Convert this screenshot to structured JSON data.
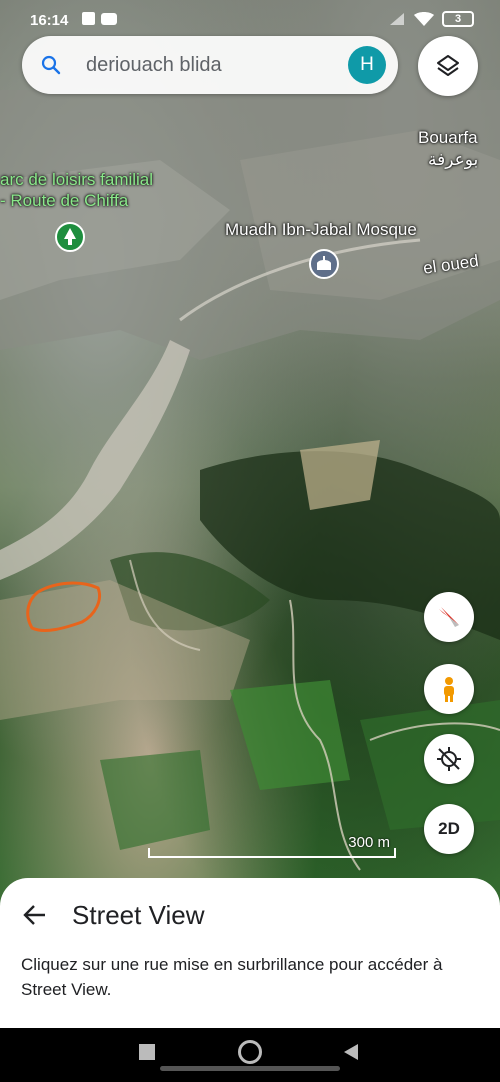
{
  "status_bar": {
    "time": "16:14",
    "battery": "3"
  },
  "search": {
    "query": "deriouach blida",
    "avatar_initial": "H"
  },
  "map_labels": {
    "bouarfa_latin": "Bouarfa",
    "bouarfa_arabic": "بوعرفة",
    "parc": "arc de loisirs familial",
    "route": "- Route de Chiffa",
    "mosque": "Muadh Ibn-Jabal Mosque",
    "el_oued": "el oued"
  },
  "controls": {
    "view_mode": "2D"
  },
  "scale": {
    "label": "300 m"
  },
  "sheet": {
    "title": "Street View",
    "body": "Cliquez sur une rue mise en surbrillance pour accéder à Street View."
  },
  "colors": {
    "accent": "#0f9aa8",
    "park_pin": "#1e8e3e",
    "highlight_outline": "#e8641b"
  }
}
